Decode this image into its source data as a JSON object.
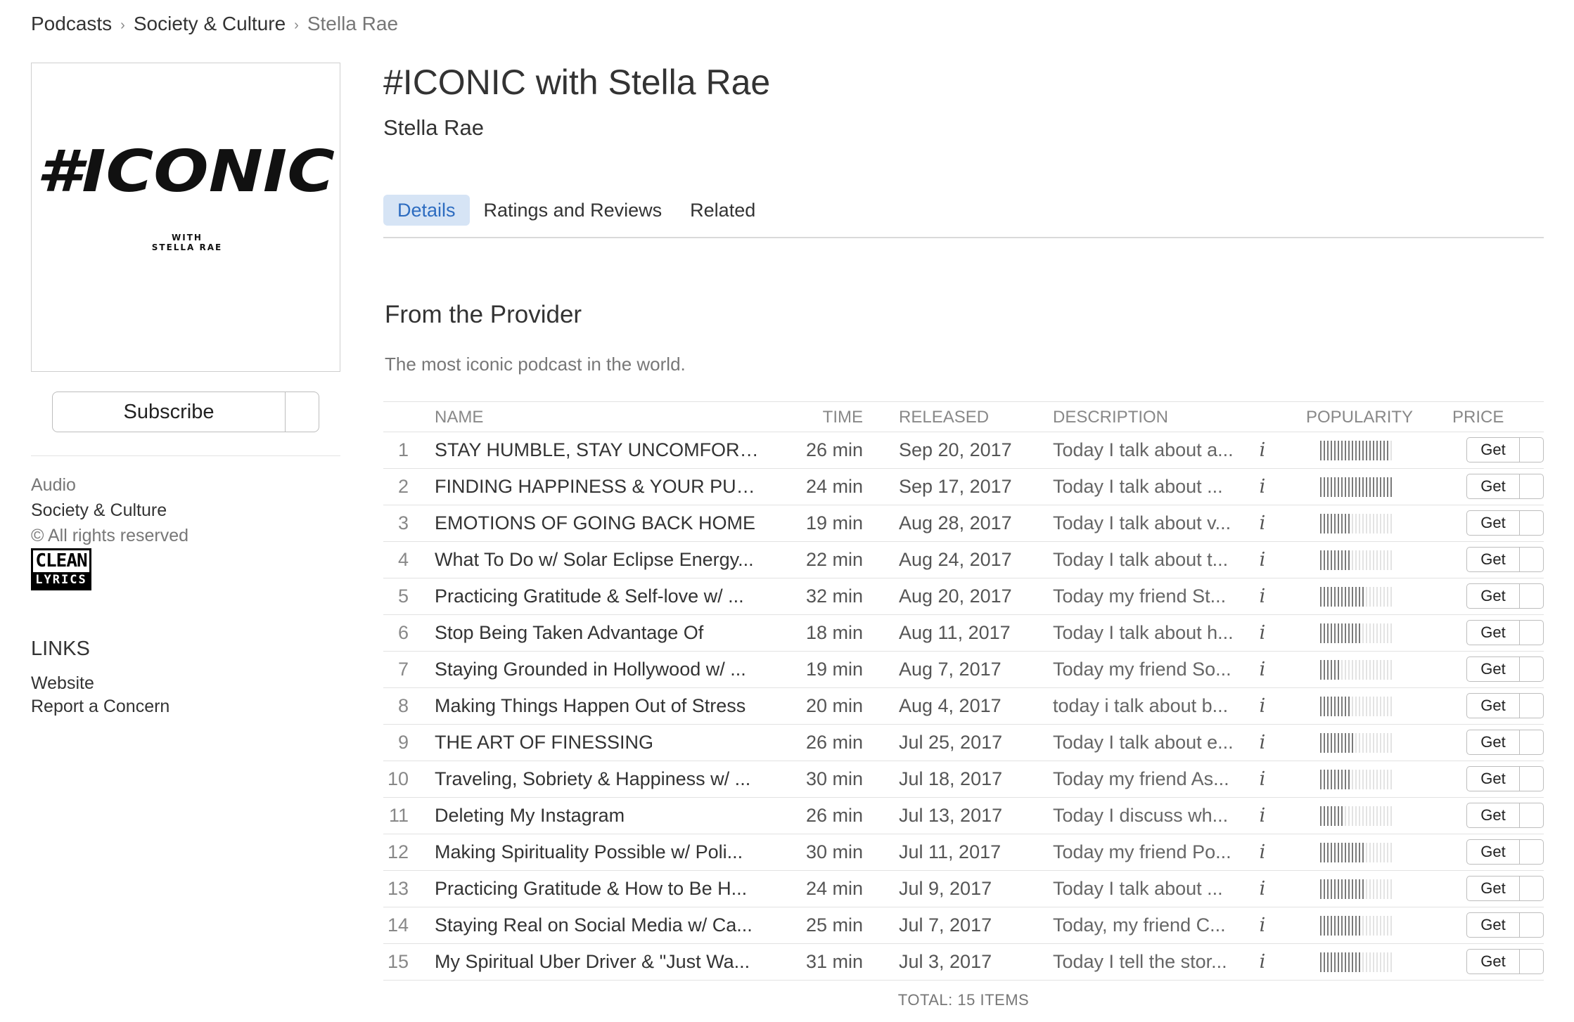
{
  "breadcrumb": {
    "items": [
      "Podcasts",
      "Society & Culture"
    ],
    "current": "Stella Rae",
    "separator": "›"
  },
  "artwork": {
    "main_text": "#ICONIC",
    "sub_line_1": "WITH",
    "sub_line_2": "STELLA RAE"
  },
  "subscribe": {
    "label": "Subscribe"
  },
  "meta": {
    "kind": "Audio",
    "genre": "Society & Culture",
    "rights": "© All rights reserved"
  },
  "badge": {
    "top": "CLEAN",
    "bottom": "LYRICS"
  },
  "links": {
    "heading": "LINKS",
    "website": "Website",
    "report": "Report a Concern"
  },
  "podcast": {
    "title": "#ICONIC with Stella Rae",
    "author": "Stella Rae"
  },
  "tabs": [
    {
      "label": "Details",
      "active": true
    },
    {
      "label": "Ratings and Reviews",
      "active": false
    },
    {
      "label": "Related",
      "active": false
    }
  ],
  "provider": {
    "heading": "From the Provider",
    "description": "The most iconic podcast in the world."
  },
  "table": {
    "headers": {
      "name": "NAME",
      "time": "TIME",
      "released": "RELEASED",
      "description": "DESCRIPTION",
      "popularity": "POPULARITY",
      "price": "PRICE"
    },
    "info_glyph": "i",
    "get_label": "Get",
    "rows": [
      {
        "num": "1",
        "name": "STAY HUMBLE, STAY UNCOMFORA...",
        "time": "26 min",
        "released": "Sep 20, 2017",
        "description": "Today I talk about a...",
        "popularity": 0.95
      },
      {
        "num": "2",
        "name": "FINDING HAPPINESS & YOUR PUR...",
        "time": "24 min",
        "released": "Sep 17, 2017",
        "description": "Today I talk about ...",
        "popularity": 1.0
      },
      {
        "num": "3",
        "name": "EMOTIONS OF GOING BACK HOME",
        "time": "19 min",
        "released": "Aug 28, 2017",
        "description": "Today I talk about v...",
        "popularity": 0.4
      },
      {
        "num": "4",
        "name": "What To Do w/ Solar Eclipse Energy...",
        "time": "22 min",
        "released": "Aug 24, 2017",
        "description": "Today I talk about t...",
        "popularity": 0.4
      },
      {
        "num": "5",
        "name": "Practicing Gratitude & Self-love w/ ...",
        "time": "32 min",
        "released": "Aug 20, 2017",
        "description": "Today my friend St...",
        "popularity": 0.62
      },
      {
        "num": "6",
        "name": "Stop Being Taken Advantage Of",
        "time": "18 min",
        "released": "Aug 11, 2017",
        "description": "Today I talk about h...",
        "popularity": 0.55
      },
      {
        "num": "7",
        "name": "Staying Grounded in Hollywood w/ ...",
        "time": "19 min",
        "released": "Aug 7, 2017",
        "description": "Today my friend So...",
        "popularity": 0.26
      },
      {
        "num": "8",
        "name": "Making Things Happen Out of Stress",
        "time": "20 min",
        "released": "Aug 4, 2017",
        "description": "today i talk about b...",
        "popularity": 0.4
      },
      {
        "num": "9",
        "name": "THE ART OF FINESSING",
        "time": "26 min",
        "released": "Jul 25, 2017",
        "description": "Today I talk about e...",
        "popularity": 0.48
      },
      {
        "num": "10",
        "name": "Traveling, Sobriety & Happiness w/ ...",
        "time": "30 min",
        "released": "Jul 18, 2017",
        "description": "Today my friend As...",
        "popularity": 0.4
      },
      {
        "num": "11",
        "name": "Deleting My Instagram",
        "time": "26 min",
        "released": "Jul 13, 2017",
        "description": "Today I discuss wh...",
        "popularity": 0.33
      },
      {
        "num": "12",
        "name": "Making Spirituality Possible w/ Poli...",
        "time": "30 min",
        "released": "Jul 11, 2017",
        "description": "Today my friend Po...",
        "popularity": 0.62
      },
      {
        "num": "13",
        "name": "Practicing Gratitude & How to Be H...",
        "time": "24 min",
        "released": "Jul 9, 2017",
        "description": "Today I talk about ...",
        "popularity": 0.62
      },
      {
        "num": "14",
        "name": "Staying Real on Social Media w/ Ca...",
        "time": "25 min",
        "released": "Jul 7, 2017",
        "description": "Today, my friend C...",
        "popularity": 0.55
      },
      {
        "num": "15",
        "name": "My Spiritual Uber Driver & \"Just Wa...",
        "time": "31 min",
        "released": "Jul 3, 2017",
        "description": "Today I tell the stor...",
        "popularity": 0.55
      }
    ],
    "total": "TOTAL: 15 ITEMS"
  },
  "colors": {
    "accent": "#2d6cc0",
    "tab_active_bg": "#d6e4f5",
    "popularity_fill": "#7a7a7a"
  }
}
